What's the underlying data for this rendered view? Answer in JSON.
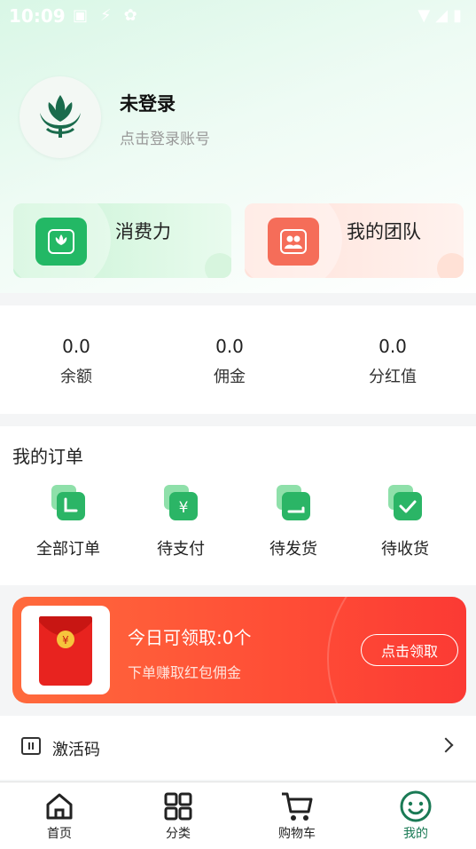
{
  "status_bar": {
    "time": "10:09"
  },
  "profile": {
    "name": "未登录",
    "hint": "点击登录账号"
  },
  "cards": [
    {
      "label": "消费力",
      "color": "#23b865"
    },
    {
      "label": "我的团队",
      "color": "#f56d59"
    }
  ],
  "stats": [
    {
      "value": "0.0",
      "label": "余额"
    },
    {
      "value": "0.0",
      "label": "佣金"
    },
    {
      "value": "0.0",
      "label": "分红值"
    }
  ],
  "orders": {
    "title": "我的订单",
    "items": [
      {
        "label": "全部订单",
        "icon": "clock-icon"
      },
      {
        "label": "待支付",
        "icon": "yen-icon"
      },
      {
        "label": "待发货",
        "icon": "shipping-icon"
      },
      {
        "label": "待收货",
        "icon": "check-icon"
      }
    ]
  },
  "red_packet": {
    "title": "今日可领取:0个",
    "subtitle": "下单赚取红包佣金",
    "button": "点击领取",
    "yen": "¥"
  },
  "menu": {
    "activation_code": "激活码"
  },
  "tabbar": [
    {
      "label": "首页",
      "icon": "home-icon"
    },
    {
      "label": "分类",
      "icon": "grid-icon"
    },
    {
      "label": "购物车",
      "icon": "cart-icon"
    },
    {
      "label": "我的",
      "icon": "smile-icon",
      "active": true
    }
  ],
  "colors": {
    "brand_green": "#1a7a55",
    "accent_red": "#fb3a34"
  }
}
